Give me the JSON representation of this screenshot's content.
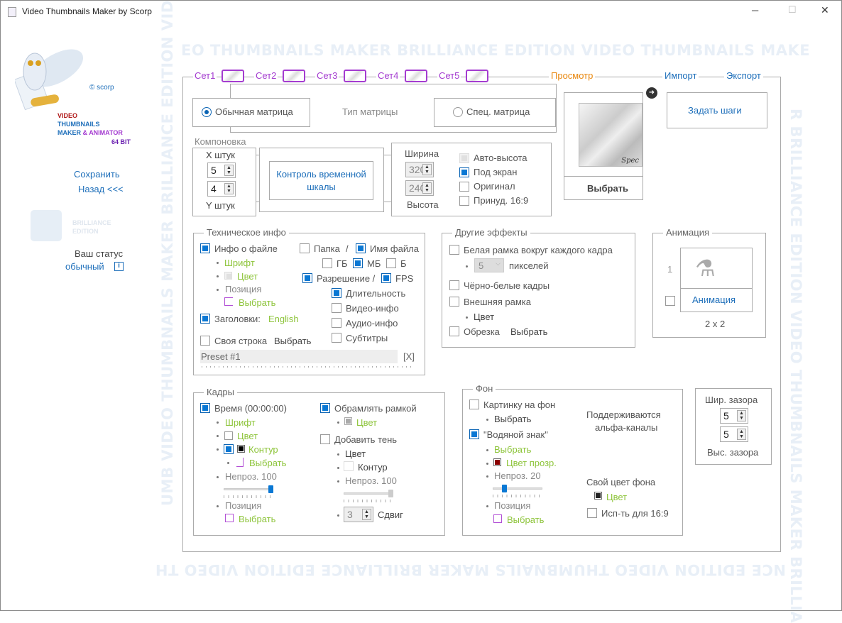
{
  "window": {
    "title": "Video Thumbnails Maker by Scorp",
    "minimize": "─",
    "maximize": "☐",
    "close": "✕"
  },
  "watermark": {
    "top": "EO THUMBNAILS MAKER  BRILLIANCE EDITION  VIDEO THUMBNAILS MAKE",
    "bottom": "NCE EDITION  VIDEO THUMBNAILS MAKER  BRILLIANCE EDITION  VIDEO TH",
    "left": "UMB  VIDEO THUMBNAILS MAKER  BRILLIANCE EDITION  VID",
    "right": "R  BRILLIANCE EDITION  VIDEO THUMBNAILS MAKER  BRILLIA"
  },
  "sidebar": {
    "copyright": "© scorp",
    "logo_line1": "VIDEO",
    "logo_line2": "THUMBNAILS",
    "logo_line3a": "MAKER",
    "logo_line3b": "&",
    "logo_line3c": "ANIMATOR",
    "logo_line4": "64 BIT",
    "save": "Сохранить",
    "back": "Назад <<<",
    "edition_line1": "BRILLIANCE",
    "edition_line2": "EDITION",
    "status_label": "Ваш статус",
    "status_value": "обычный",
    "info_icon": "i"
  },
  "tabs": {
    "sets": [
      "Сет1",
      "Сет2",
      "Сет3",
      "Сет4",
      "Сет5"
    ],
    "preview": "Просмотр",
    "import": "Импорт",
    "export": "Экспорт"
  },
  "matrix": {
    "normal": "Обычная матрица",
    "label": "Тип матрицы",
    "special": "Спец. матрица",
    "normal_selected": true,
    "preview_caption": "Spec",
    "choose": "Выбрать",
    "set_steps": "Задать шаги"
  },
  "layout": {
    "label": "Компоновка",
    "x_label": "X штук",
    "x_value": "5",
    "y_value": "4",
    "y_label": "Y штук",
    "timeline_button": "Контроль временной шкалы",
    "width_label": "Ширина",
    "width_value": "320",
    "height_value": "240",
    "height_label": "Высота",
    "auto_height": "Авто-высота",
    "fit_screen": "Под экран",
    "original": "Оригинал",
    "force169": "Принуд. 16:9"
  },
  "tech": {
    "legend": "Техническое  инфо",
    "file_info": "Инфо о файле",
    "font": "Шрифт",
    "color": "Цвет",
    "position": "Позиция",
    "choose": "Выбрать",
    "headers": "Заголовки:",
    "headers_lang": "English",
    "custom_line": "Своя строка",
    "custom_choose": "Выбрать",
    "folder": "Папка",
    "slash": "/",
    "filename": "Имя файла",
    "gb": "ГБ",
    "mb": "МБ",
    "b": "Б",
    "resolution": "Разрешение /",
    "fps": "FPS",
    "duration": "Длительность",
    "video_info": "Видео-инфо",
    "audio_info": "Аудио-инфо",
    "subtitles": "Субтитры",
    "preset": "Preset #1",
    "preset_clear": "[X]"
  },
  "effects": {
    "legend": "Другие эффекты",
    "white_frame": "Белая рамка вокруг каждого кадра",
    "pixels_value": "5",
    "pixels": "пикселей",
    "bw": "Чёрно-белые кадры",
    "outer_frame": "Внешняя рамка",
    "color": "Цвет",
    "crop": "Обрезка",
    "crop_choose": "Выбрать"
  },
  "animation": {
    "legend": "Анимация",
    "count": "1",
    "button": "Анимация",
    "grid": "2 x 2"
  },
  "frames": {
    "legend": "Кадры",
    "time": "Время (00:00:00)",
    "font": "Шрифт",
    "color": "Цвет",
    "outline": "Контур",
    "choose": "Выбрать",
    "opacity": "Непроз. 100",
    "opacity_value": 100,
    "position": "Позиция",
    "pos_choose": "Выбрать",
    "border": "Обрамлять рамкой",
    "border_color": "Цвет",
    "shadow": "Добавить тень",
    "shadow_color": "Цвет",
    "shadow_outline": "Контур",
    "shadow_opacity": "Непроз. 100",
    "shadow_opacity_value": 100,
    "offset_value": "3",
    "offset": "Сдвиг"
  },
  "background": {
    "legend": "Фон",
    "picture": "Картинку на фон",
    "picture_choose": "Выбрать",
    "watermark": "\"Водяной знак\"",
    "wm_choose": "Выбрать",
    "wm_color": "Цвет прозр.",
    "wm_opacity": "Непроз. 20",
    "wm_opacity_value": 20,
    "position": "Позиция",
    "pos_choose": "Выбрать",
    "alpha1": "Поддерживаются",
    "alpha2": "альфа-каналы",
    "own_color": "Свой цвет фона",
    "color": "Цвет",
    "use169": "Исп-ть для 16:9"
  },
  "gap": {
    "width_label": "Шир. зазора",
    "width_value": "5",
    "height_value": "5",
    "height_label": "Выс. зазора"
  },
  "colors": {
    "purple": "#a43cd0",
    "orange": "#e8860c",
    "blue": "#1e6fba",
    "green": "#8dc43a",
    "checkbox": "#0a78d4",
    "wm_transparent": "#8b0000"
  }
}
